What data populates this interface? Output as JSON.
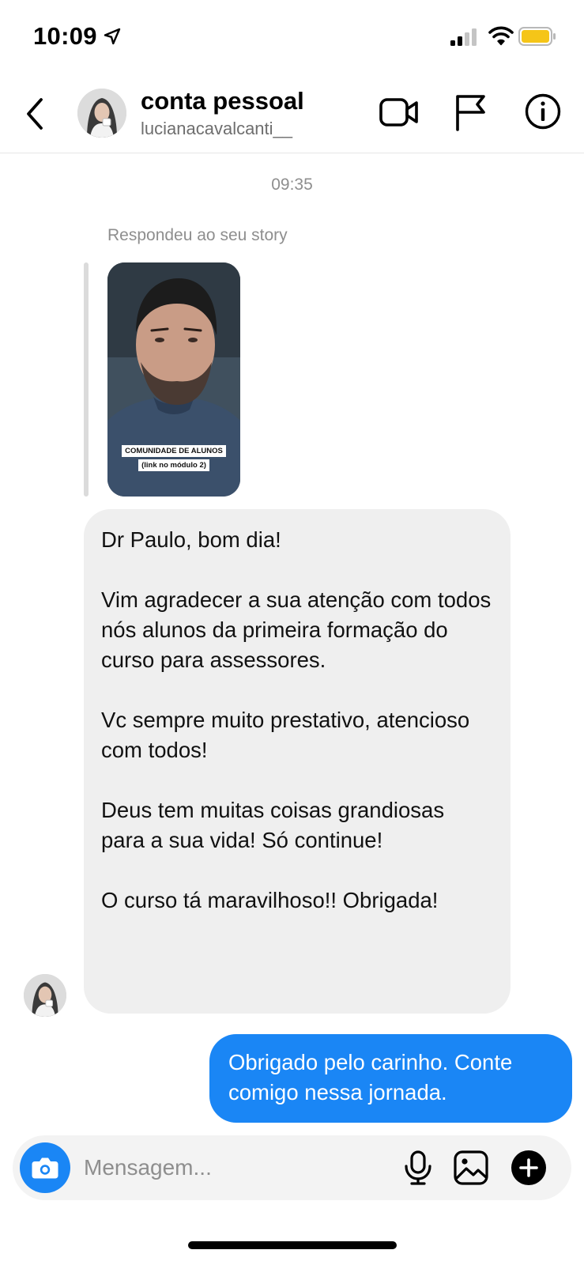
{
  "status_bar": {
    "time": "10:09",
    "icons": [
      "location-arrow-icon",
      "cellular-signal-icon",
      "wifi-icon",
      "battery-icon"
    ],
    "battery_color": "#f5c518"
  },
  "header": {
    "name": "conta pessoal",
    "username": "lucianacavalcanti__",
    "icons": [
      "back-icon",
      "video-call-icon",
      "flag-icon",
      "info-icon"
    ]
  },
  "conversation": {
    "timestamp": "09:35",
    "story_reply_label": "Respondeu ao seu story",
    "story_caption_line1": "COMUNIDADE DE ALUNOS",
    "story_caption_line2": "(link no módulo 2)",
    "received_paragraphs": [
      "Dr Paulo, bom dia!",
      "Vim agradecer a sua atenção com todos nós alunos da primeira formação do curso para assessores.",
      "Vc sempre muito prestativo, atencioso com todos!",
      "Deus tem muitas coisas grandiosas para a sua vida! Só continue!",
      "O curso tá maravilhoso!! Obrigada!"
    ],
    "sent_message": "Obrigado pelo carinho. Conte comigo nessa jornada."
  },
  "composer": {
    "placeholder": "Mensagem...",
    "icons": [
      "camera-icon",
      "microphone-icon",
      "gallery-icon",
      "plus-icon"
    ]
  },
  "colors": {
    "accent_blue": "#1a86f5",
    "received_bubble": "#efefef",
    "secondary_text": "#8e8e8e"
  }
}
